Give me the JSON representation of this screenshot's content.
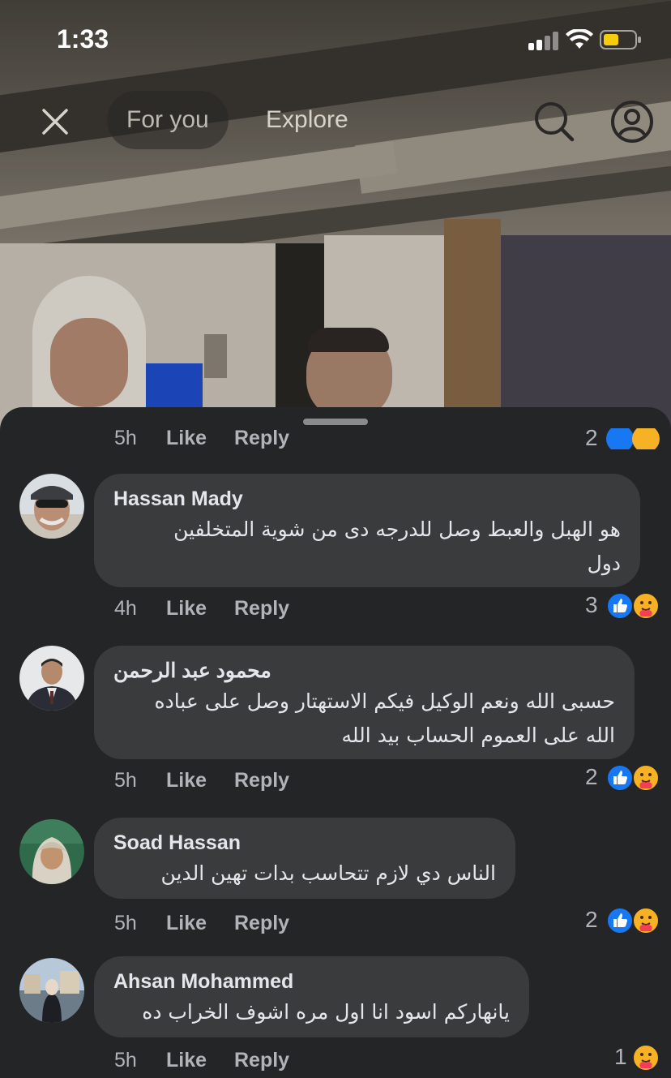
{
  "status_bar": {
    "time": "1:33"
  },
  "nav": {
    "tabs": [
      {
        "label": "For you",
        "active": true
      },
      {
        "label": "Explore",
        "active": false
      }
    ]
  },
  "comments": {
    "partial_row": {
      "time": "5h",
      "like": "Like",
      "reply": "Reply",
      "reaction_count": "2"
    },
    "items": [
      {
        "author": "Hassan Mady",
        "text_line1": "هو الهبل والعبط وصل للدرجه دى من شوية المتخلفين",
        "text_line2": "دول",
        "time": "4h",
        "like": "Like",
        "reply": "Reply",
        "reaction_count": "3",
        "reactions": [
          "like-icon",
          "care-icon"
        ]
      },
      {
        "author": "محمود عبد الرحمن",
        "text_line1": "حسبى الله ونعم الوكيل فيكم الاستهتار وصل على عباده",
        "text_line2": "الله على العموم الحساب بيد الله",
        "time": "5h",
        "like": "Like",
        "reply": "Reply",
        "reaction_count": "2",
        "reactions": [
          "like-icon",
          "care-icon"
        ]
      },
      {
        "author": "Soad Hassan",
        "text_line1": "الناس دي لازم تتحاسب بدات  تهين الدين",
        "time": "5h",
        "like": "Like",
        "reply": "Reply",
        "reaction_count": "2",
        "reactions": [
          "like-icon",
          "care-icon"
        ]
      },
      {
        "author": "Ahsan Mohammed",
        "text_line1": "يانهاركم اسود انا اول مره اشوف الخراب ده",
        "time": "5h",
        "like": "Like",
        "reply": "Reply",
        "reaction_count": "1",
        "reactions": [
          "care-icon"
        ]
      }
    ]
  },
  "colors": {
    "sheet_bg": "#242526",
    "bubble_bg": "#3a3b3c",
    "like_blue": "#1877f2",
    "muted_text": "#b0b3b8"
  }
}
